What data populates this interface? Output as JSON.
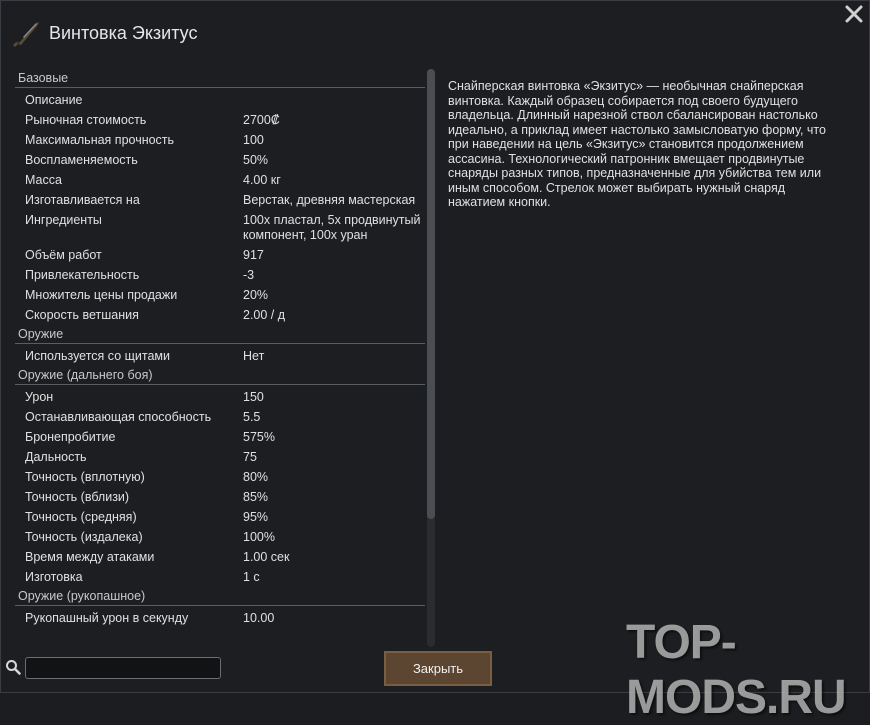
{
  "window": {
    "title": "Винтовка Экзитус",
    "close_icon": "close-icon"
  },
  "stats": [
    {
      "category": "Базовые",
      "rows": [
        {
          "label": "Описание",
          "value": ""
        },
        {
          "label": "Рыночная стоимость",
          "value": "2700₡"
        },
        {
          "label": "Максимальная прочность",
          "value": "100"
        },
        {
          "label": "Воспламеняемость",
          "value": "50%"
        },
        {
          "label": "Масса",
          "value": "4.00 кг"
        },
        {
          "label": "Изготавливается на",
          "value": "Верстак, древняя мастерская"
        },
        {
          "label": "Ингредиенты",
          "value": "100x пластал, 5x продвинутый компонент, 100x уран"
        },
        {
          "label": "Объём работ",
          "value": "917"
        },
        {
          "label": "Привлекательность",
          "value": "-3"
        },
        {
          "label": "Множитель цены продажи",
          "value": "20%"
        },
        {
          "label": "Скорость ветшания",
          "value": "2.00 / д"
        }
      ]
    },
    {
      "category": "Оружие",
      "rows": [
        {
          "label": "Используется со щитами",
          "value": "Нет"
        }
      ]
    },
    {
      "category": "Оружие (дальнего боя)",
      "rows": [
        {
          "label": "Урон",
          "value": "150"
        },
        {
          "label": "Останавливающая способность",
          "value": "5.5"
        },
        {
          "label": "Бронепробитие",
          "value": "575%"
        },
        {
          "label": "Дальность",
          "value": "75"
        },
        {
          "label": "Точность (вплотную)",
          "value": "80%"
        },
        {
          "label": "Точность (вблизи)",
          "value": "85%"
        },
        {
          "label": "Точность (средняя)",
          "value": "95%"
        },
        {
          "label": "Точность (издалека)",
          "value": "100%"
        },
        {
          "label": "Время между атаками",
          "value": "1.00 сек"
        },
        {
          "label": "Изготовка",
          "value": "1 с"
        }
      ]
    },
    {
      "category": "Оружие (рукопашное)",
      "rows": [
        {
          "label": "Рукопашный урон в секунду",
          "value": "10.00"
        }
      ]
    }
  ],
  "description": "Снайперская винтовка «Экзитус» — необычная снайперская винтовка. Каждый образец собирается под своего будущего владельца. Длинный нарезной ствол сбалансирован настолько идеально, а приклад имеет настолько замысловатую форму, что при наведении на цель «Экзитус» становится продолжением ассасина. Технологический патронник вмещает продвинутые снаряды разных типов, предназначенные для убийства тем или иным способом. Стрелок может выбирать нужный снаряд нажатием кнопки.",
  "search": {
    "value": "",
    "icon": "search-icon"
  },
  "buttons": {
    "close_label": "Закрыть"
  },
  "watermark": "TOP-MODS.RU"
}
